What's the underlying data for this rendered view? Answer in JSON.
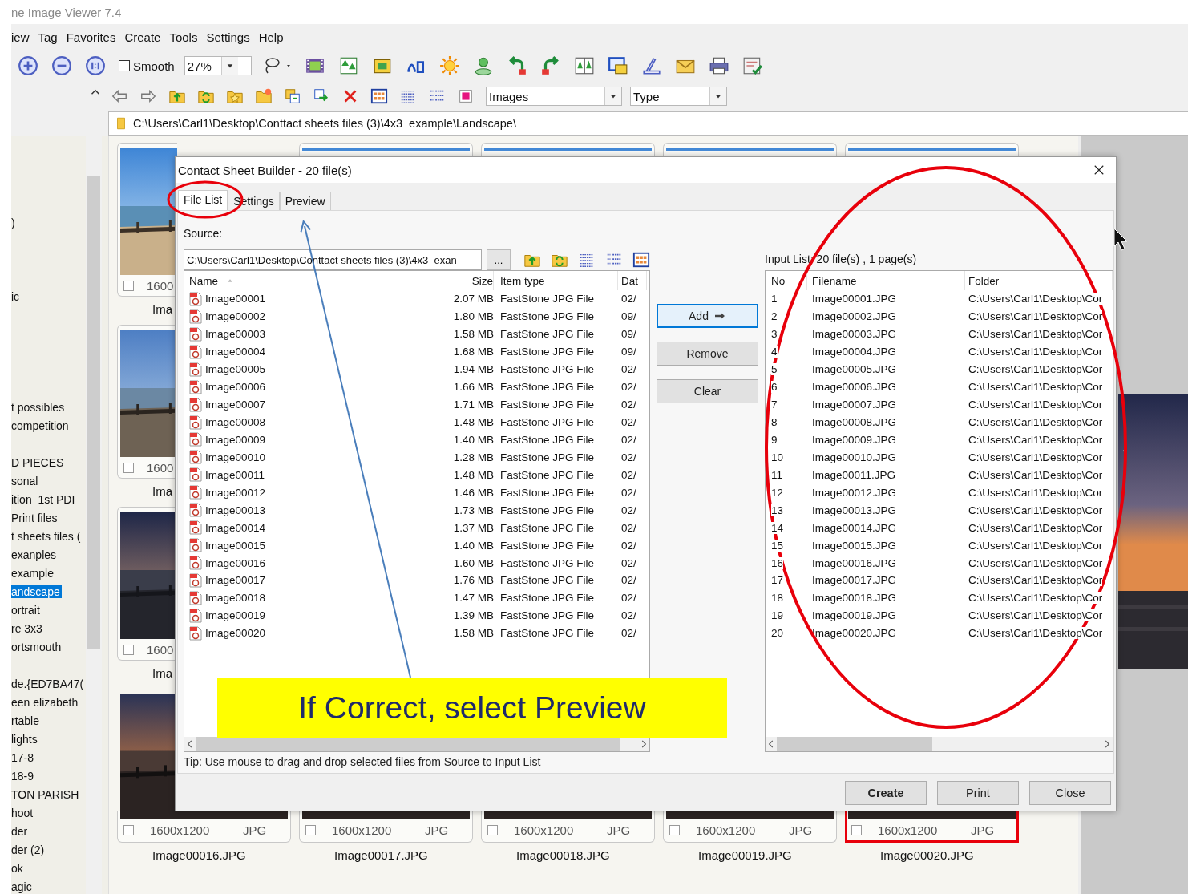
{
  "window": {
    "title": "ne Image Viewer 7.4"
  },
  "menu": [
    "iew",
    "Tag",
    "Favorites",
    "Create",
    "Tools",
    "Settings",
    "Help"
  ],
  "toolbar": {
    "smooth": {
      "label": "Smooth",
      "checked": false
    },
    "zoom": "27%"
  },
  "browser_bar": {
    "filter": "Images",
    "sort": "Type"
  },
  "path": "C:\\Users\\Carl1\\Desktop\\Conttact sheets files (3)\\4x3  example\\Landscape\\",
  "folder_tree": [
    {
      "label": ")",
      "selected": false
    },
    {
      "label": "ic",
      "selected": false
    },
    {
      "label": "t possibles",
      "selected": false
    },
    {
      "label": "competition",
      "selected": false
    },
    {
      "label": "D PIECES",
      "selected": false
    },
    {
      "label": "sonal",
      "selected": false
    },
    {
      "label": "ition  1st PDI",
      "selected": false
    },
    {
      "label": "Print files",
      "selected": false
    },
    {
      "label": "t sheets files (",
      "selected": false
    },
    {
      "label": "exanples",
      "selected": false
    },
    {
      "label": "example",
      "selected": false
    },
    {
      "label": "andscape",
      "selected": true
    },
    {
      "label": "ortrait",
      "selected": false
    },
    {
      "label": "re 3x3",
      "selected": false
    },
    {
      "label": "ortsmouth",
      "selected": false
    },
    {
      "label": "de.{ED7BA47(",
      "selected": false
    },
    {
      "label": "een elizabeth",
      "selected": false
    },
    {
      "label": "rtable",
      "selected": false
    },
    {
      "label": "lights",
      "selected": false
    },
    {
      "label": "17-8",
      "selected": false
    },
    {
      "label": "18-9",
      "selected": false
    },
    {
      "label": "TON PARISH",
      "selected": false
    },
    {
      "label": "hoot",
      "selected": false
    },
    {
      "label": "der",
      "selected": false
    },
    {
      "label": "der (2)",
      "selected": false
    },
    {
      "label": "ok",
      "selected": false
    },
    {
      "label": "agic",
      "selected": false
    }
  ],
  "thumbnails": [
    {
      "kind": "picture",
      "checked": false,
      "size": "1600",
      "name": "Ima",
      "highlighted": false
    },
    {
      "kind": "picture",
      "highlighted": false
    },
    {
      "kind": "picture",
      "highlighted": false
    },
    {
      "kind": "picture",
      "highlighted": false
    },
    {
      "kind": "picture",
      "highlighted": false
    },
    {
      "kind": "picture",
      "checked": false,
      "size": "1600",
      "name": "Ima",
      "highlighted": false
    },
    {
      "kind": "picture",
      "checked": false,
      "size": "1600",
      "name": "Ima",
      "highlighted": false
    },
    {
      "kind": "picture",
      "checked": false,
      "size": "1600x1200",
      "format": "JPG",
      "name": "Image00016.JPG",
      "highlighted": false
    },
    {
      "kind": "picture",
      "checked": false,
      "size": "1600x1200",
      "format": "JPG",
      "name": "Image00017.JPG",
      "highlighted": false
    },
    {
      "kind": "picture",
      "checked": false,
      "size": "1600x1200",
      "format": "JPG",
      "name": "Image00018.JPG",
      "highlighted": false
    },
    {
      "kind": "picture",
      "checked": false,
      "size": "1600x1200",
      "format": "JPG",
      "name": "Image00019.JPG",
      "highlighted": false
    },
    {
      "kind": "picture",
      "checked": false,
      "size": "1600x1200",
      "format": "JPG",
      "name": "Image00020.JPG",
      "highlighted": true
    }
  ],
  "preview": {
    "kind": "picture"
  },
  "dialog": {
    "title": "Contact Sheet Builder - 20 file(s)",
    "tabs": [
      {
        "label": "File List",
        "selected": true
      },
      {
        "label": "Settings",
        "selected": false
      },
      {
        "label": "Preview",
        "selected": false
      }
    ],
    "source_label": "Source:",
    "source_path": "C:\\Users\\Carl1\\Desktop\\Conttact sheets files (3)\\4x3  exan",
    "browse_button": "...",
    "source_list": {
      "columns": [
        "Name",
        "Size",
        "Item type",
        "Dat"
      ],
      "rows": [
        {
          "name": "Image00001",
          "size": "2.07 MB",
          "type": "FastStone JPG File",
          "date": "02/"
        },
        {
          "name": "Image00002",
          "size": "1.80 MB",
          "type": "FastStone JPG File",
          "date": "09/"
        },
        {
          "name": "Image00003",
          "size": "1.58 MB",
          "type": "FastStone JPG File",
          "date": "09/"
        },
        {
          "name": "Image00004",
          "size": "1.68 MB",
          "type": "FastStone JPG File",
          "date": "09/"
        },
        {
          "name": "Image00005",
          "size": "1.94 MB",
          "type": "FastStone JPG File",
          "date": "02/"
        },
        {
          "name": "Image00006",
          "size": "1.66 MB",
          "type": "FastStone JPG File",
          "date": "02/"
        },
        {
          "name": "Image00007",
          "size": "1.71 MB",
          "type": "FastStone JPG File",
          "date": "02/"
        },
        {
          "name": "Image00008",
          "size": "1.48 MB",
          "type": "FastStone JPG File",
          "date": "02/"
        },
        {
          "name": "Image00009",
          "size": "1.40 MB",
          "type": "FastStone JPG File",
          "date": "02/"
        },
        {
          "name": "Image00010",
          "size": "1.28 MB",
          "type": "FastStone JPG File",
          "date": "02/"
        },
        {
          "name": "Image00011",
          "size": "1.48 MB",
          "type": "FastStone JPG File",
          "date": "02/"
        },
        {
          "name": "Image00012",
          "size": "1.46 MB",
          "type": "FastStone JPG File",
          "date": "02/"
        },
        {
          "name": "Image00013",
          "size": "1.73 MB",
          "type": "FastStone JPG File",
          "date": "02/"
        },
        {
          "name": "Image00014",
          "size": "1.37 MB",
          "type": "FastStone JPG File",
          "date": "02/"
        },
        {
          "name": "Image00015",
          "size": "1.40 MB",
          "type": "FastStone JPG File",
          "date": "02/"
        },
        {
          "name": "Image00016",
          "size": "1.60 MB",
          "type": "FastStone JPG File",
          "date": "02/"
        },
        {
          "name": "Image00017",
          "size": "1.76 MB",
          "type": "FastStone JPG File",
          "date": "02/"
        },
        {
          "name": "Image00018",
          "size": "1.47 MB",
          "type": "FastStone JPG File",
          "date": "02/"
        },
        {
          "name": "Image00019",
          "size": "1.39 MB",
          "type": "FastStone JPG File",
          "date": "02/"
        },
        {
          "name": "Image00020",
          "size": "1.58 MB",
          "type": "FastStone JPG File",
          "date": "02/"
        }
      ]
    },
    "buttons": [
      {
        "label": "Add",
        "kind": "arrow",
        "focused": true
      },
      {
        "label": "Remove",
        "kind": "plain",
        "focused": false
      },
      {
        "label": "Clear",
        "kind": "plain",
        "focused": false
      }
    ],
    "input_label": "Input List: 20 file(s) , 1 page(s)",
    "input_list": {
      "columns": [
        "No",
        "Filename",
        "Folder"
      ],
      "rows": [
        {
          "no": "1",
          "filename": "Image00001.JPG",
          "folder": "C:\\Users\\Carl1\\Desktop\\Cor"
        },
        {
          "no": "2",
          "filename": "Image00002.JPG",
          "folder": "C:\\Users\\Carl1\\Desktop\\Cor"
        },
        {
          "no": "3",
          "filename": "Image00003.JPG",
          "folder": "C:\\Users\\Carl1\\Desktop\\Cor"
        },
        {
          "no": "4",
          "filename": "Image00004.JPG",
          "folder": "C:\\Users\\Carl1\\Desktop\\Cor"
        },
        {
          "no": "5",
          "filename": "Image00005.JPG",
          "folder": "C:\\Users\\Carl1\\Desktop\\Cor"
        },
        {
          "no": "6",
          "filename": "Image00006.JPG",
          "folder": "C:\\Users\\Carl1\\Desktop\\Cor"
        },
        {
          "no": "7",
          "filename": "Image00007.JPG",
          "folder": "C:\\Users\\Carl1\\Desktop\\Cor"
        },
        {
          "no": "8",
          "filename": "Image00008.JPG",
          "folder": "C:\\Users\\Carl1\\Desktop\\Cor"
        },
        {
          "no": "9",
          "filename": "Image00009.JPG",
          "folder": "C:\\Users\\Carl1\\Desktop\\Cor"
        },
        {
          "no": "10",
          "filename": "Image00010.JPG",
          "folder": "C:\\Users\\Carl1\\Desktop\\Cor"
        },
        {
          "no": "11",
          "filename": "Image00011.JPG",
          "folder": "C:\\Users\\Carl1\\Desktop\\Cor"
        },
        {
          "no": "12",
          "filename": "Image00012.JPG",
          "folder": "C:\\Users\\Carl1\\Desktop\\Cor"
        },
        {
          "no": "13",
          "filename": "Image00013.JPG",
          "folder": "C:\\Users\\Carl1\\Desktop\\Cor"
        },
        {
          "no": "14",
          "filename": "Image00014.JPG",
          "folder": "C:\\Users\\Carl1\\Desktop\\Cor"
        },
        {
          "no": "15",
          "filename": "Image00015.JPG",
          "folder": "C:\\Users\\Carl1\\Desktop\\Cor"
        },
        {
          "no": "16",
          "filename": "Image00016.JPG",
          "folder": "C:\\Users\\Carl1\\Desktop\\Cor"
        },
        {
          "no": "17",
          "filename": "Image00017.JPG",
          "folder": "C:\\Users\\Carl1\\Desktop\\Cor"
        },
        {
          "no": "18",
          "filename": "Image00018.JPG",
          "folder": "C:\\Users\\Carl1\\Desktop\\Cor"
        },
        {
          "no": "19",
          "filename": "Image00019.JPG",
          "folder": "C:\\Users\\Carl1\\Desktop\\Cor"
        },
        {
          "no": "20",
          "filename": "Image00020.JPG",
          "folder": "C:\\Users\\Carl1\\Desktop\\Cor"
        }
      ]
    },
    "tip": "Tip: Use mouse to drag and drop selected files from Source to Input List",
    "actions": [
      {
        "label": "Create",
        "default": true
      },
      {
        "label": "Print",
        "default": false
      },
      {
        "label": "Close",
        "default": false
      }
    ]
  },
  "annotation": {
    "callout": "If Correct, select Preview"
  }
}
